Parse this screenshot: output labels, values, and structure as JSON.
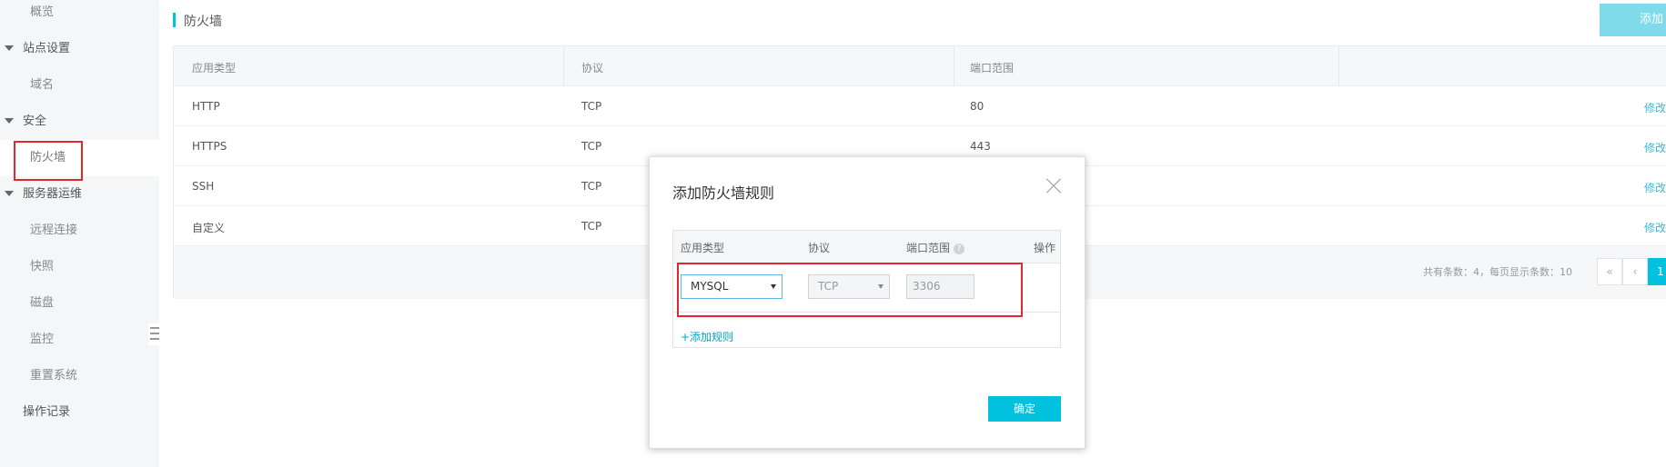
{
  "sidebar": {
    "overview": "概览",
    "site_settings": "站点设置",
    "domain": "域名",
    "security": "安全",
    "firewall": "防火墙",
    "server_ops": "服务器运维",
    "remote_connect": "远程连接",
    "snapshot": "快照",
    "disk": "磁盘",
    "monitor": "监控",
    "reset_system": "重置系统",
    "operation_log": "操作记录"
  },
  "header": {
    "title": "防火墙",
    "add_button": "添加"
  },
  "table": {
    "headers": [
      "应用类型",
      "协议",
      "端口范围"
    ],
    "rows": [
      {
        "app": "HTTP",
        "protocol": "TCP",
        "port": "80",
        "action": "修改"
      },
      {
        "app": "HTTPS",
        "protocol": "TCP",
        "port": "443",
        "action": "修改"
      },
      {
        "app": "SSH",
        "protocol": "TCP",
        "port": "",
        "action": "修改"
      },
      {
        "app": "自定义",
        "protocol": "TCP",
        "port": "",
        "action": "修改"
      }
    ]
  },
  "pagination": {
    "summary": "共有条数：4，每页显示条数：10",
    "first": "«",
    "prev": "‹",
    "current": "1"
  },
  "modal": {
    "title": "添加防火墙规则",
    "headers": {
      "app": "应用类型",
      "protocol": "协议",
      "port": "端口范围",
      "action": "操作"
    },
    "app_value": "MYSQL",
    "protocol_value": "TCP",
    "port_value": "3306",
    "add_rule": "+添加规则",
    "confirm": "确定"
  },
  "colors": {
    "accent": "#00c1de",
    "highlight": "#e0282e",
    "link": "#39b9d9"
  }
}
